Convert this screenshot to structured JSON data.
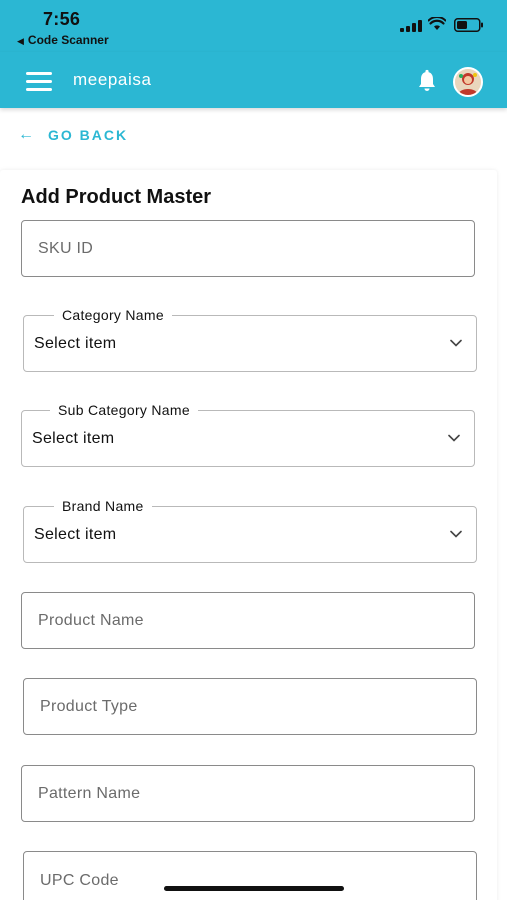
{
  "status_bar": {
    "time": "7:56",
    "back_app": "Code Scanner",
    "back_glyph": "◀"
  },
  "header": {
    "title": "meepaisa",
    "background_color": "#2bb7d3",
    "menu_icon": "hamburger-menu-icon",
    "notification_icon": "bell-icon",
    "avatar_icon": "avatar"
  },
  "nav": {
    "go_back_arrow": "←",
    "go_back_label": "GO BACK"
  },
  "form": {
    "title": "Add Product Master",
    "sku_placeholder": "SKU ID",
    "category": {
      "label": "Category Name",
      "value": "Select item"
    },
    "sub_category": {
      "label": "Sub Category Name",
      "value": "Select item"
    },
    "brand": {
      "label": "Brand Name",
      "value": "Select item"
    },
    "product_name_placeholder": "Product Name",
    "product_type_placeholder": "Product Type",
    "pattern_name_placeholder": "Pattern Name",
    "upc_code_placeholder": "UPC Code"
  }
}
